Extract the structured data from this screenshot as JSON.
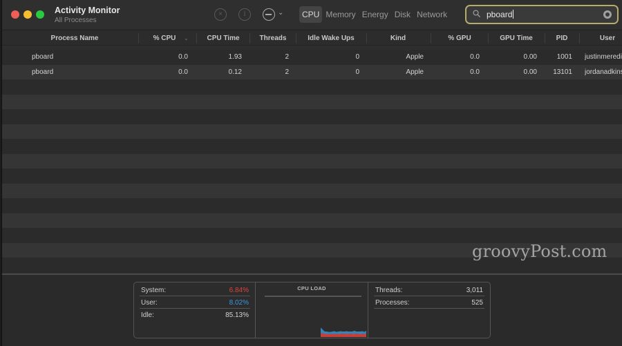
{
  "window": {
    "title": "Activity Monitor",
    "subtitle": "All Processes"
  },
  "toolbar": {
    "stop_icon": "stop-process-icon",
    "info_icon": "info-icon",
    "more_icon": "more-options-icon",
    "more_chevron": "⌄",
    "info_glyph": "i",
    "tabs": [
      {
        "label": "CPU",
        "active": true
      },
      {
        "label": "Memory",
        "active": false
      },
      {
        "label": "Energy",
        "active": false
      },
      {
        "label": "Disk",
        "active": false
      },
      {
        "label": "Network",
        "active": false
      }
    ]
  },
  "search": {
    "value": "pboard",
    "icon": "search-icon",
    "clear_icon": "clear-search-icon",
    "accent_color": "#b5ad6a"
  },
  "table": {
    "sort_indicator": "⌄",
    "columns": [
      "Process Name",
      "% CPU",
      "CPU Time",
      "Threads",
      "Idle Wake Ups",
      "Kind",
      "% GPU",
      "GPU Time",
      "PID",
      "User"
    ],
    "rows": [
      {
        "name": "pboard",
        "cpu": "0.0",
        "cpu_time": "1.93",
        "threads": "2",
        "idle_wake_ups": "0",
        "kind": "Apple",
        "gpu": "0.0",
        "gpu_time": "0.00",
        "pid": "1001",
        "user": "justinmeredith"
      },
      {
        "name": "pboard",
        "cpu": "0.0",
        "cpu_time": "0.12",
        "threads": "2",
        "idle_wake_ups": "0",
        "kind": "Apple",
        "gpu": "0.0",
        "gpu_time": "0.00",
        "pid": "13101",
        "user": "jordanadkins"
      }
    ],
    "empty_rows": 13
  },
  "summary": {
    "system_label": "System:",
    "system_value": "6.84%",
    "system_color": "#e0443e",
    "user_label": "User:",
    "user_value": "8.02%",
    "user_color": "#3a9ad9",
    "idle_label": "Idle:",
    "idle_value": "85.13%",
    "chart_title": "CPU LOAD",
    "threads_label": "Threads:",
    "threads_value": "3,011",
    "processes_label": "Processes:",
    "processes_value": "525",
    "cpu_load_history": {
      "system": [
        10,
        9,
        8,
        8,
        8,
        7,
        8,
        8,
        7,
        8,
        8,
        9,
        8,
        8,
        8,
        9,
        8,
        8,
        9,
        8,
        8,
        8,
        7,
        8
      ],
      "user": [
        14,
        10,
        6,
        6,
        5,
        6,
        6,
        7,
        6,
        6,
        7,
        5,
        6,
        7,
        6,
        5,
        6,
        8,
        5,
        6,
        6,
        7,
        6,
        8
      ]
    }
  },
  "watermark": "groovyPost.com"
}
